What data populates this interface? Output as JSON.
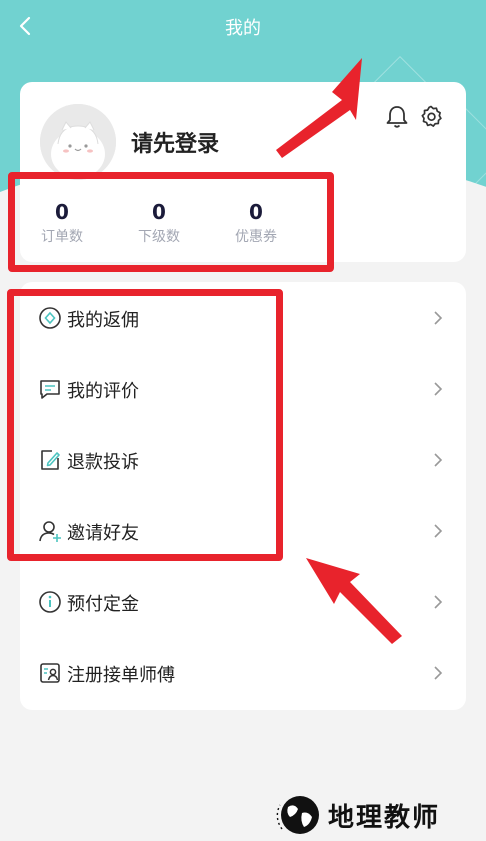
{
  "header": {
    "title": "我的"
  },
  "profile": {
    "login_prompt": "请先登录",
    "stats": [
      {
        "value": "0",
        "label": "订单数"
      },
      {
        "value": "0",
        "label": "下级数"
      },
      {
        "value": "0",
        "label": "优惠券"
      }
    ]
  },
  "menu": {
    "items": [
      {
        "label": "我的返佣",
        "icon": "rebate-icon"
      },
      {
        "label": "我的评价",
        "icon": "review-icon"
      },
      {
        "label": "退款投诉",
        "icon": "refund-complaint-icon"
      },
      {
        "label": "邀请好友",
        "icon": "invite-friend-icon"
      },
      {
        "label": "预付定金",
        "icon": "deposit-icon"
      },
      {
        "label": "注册接单师傅",
        "icon": "register-master-icon"
      }
    ]
  },
  "watermark": {
    "text": "地理教师"
  },
  "colors": {
    "accent": "#71d2d0",
    "annotation": "#e8232c"
  }
}
